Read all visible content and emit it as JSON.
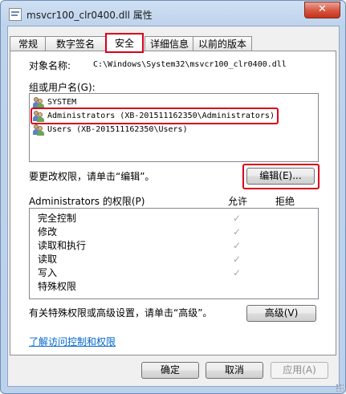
{
  "window": {
    "title": "msvcr100_clr0400.dll 属性",
    "close_glyph": "✕"
  },
  "tabs": [
    {
      "label": "常规",
      "active": false
    },
    {
      "label": "数字签名",
      "active": false
    },
    {
      "label": "安全",
      "active": true
    },
    {
      "label": "详细信息",
      "active": false
    },
    {
      "label": "以前的版本",
      "active": false
    }
  ],
  "security": {
    "object_label": "对象名称:",
    "object_value": "C:\\Windows\\System32\\msvcr100_clr0400.dll",
    "groups_label": "组或用户名(G):",
    "groups": [
      {
        "name": "SYSTEM",
        "icon": "users-icon"
      },
      {
        "name": "Administrators (XB-201511162350\\Administrators)",
        "icon": "users-icon",
        "highlighted": true
      },
      {
        "name": "Users (XB-201511162350\\Users)",
        "icon": "users-icon"
      }
    ],
    "change_hint": "要更改权限，请单击“编辑”。",
    "edit_button": "编辑(E)...",
    "perm_title": "Administrators 的权限(P)",
    "allow_header": "允许",
    "deny_header": "拒绝",
    "permissions": [
      {
        "name": "完全控制",
        "allow": "✓"
      },
      {
        "name": "修改",
        "allow": "✓"
      },
      {
        "name": "读取和执行",
        "allow": "✓"
      },
      {
        "name": "读取",
        "allow": "✓"
      },
      {
        "name": "写入",
        "allow": "✓"
      },
      {
        "name": "特殊权限",
        "allow": ""
      }
    ],
    "advanced_hint": "有关特殊权限或高级设置，请单击“高级”。",
    "advanced_button": "高级(V)",
    "learn_link": "了解访问控制和权限"
  },
  "footer": {
    "ok": "确定",
    "cancel": "取消",
    "apply": "应用(A)"
  },
  "colors": {
    "highlight": "#d9001b",
    "link": "#0066cc"
  }
}
